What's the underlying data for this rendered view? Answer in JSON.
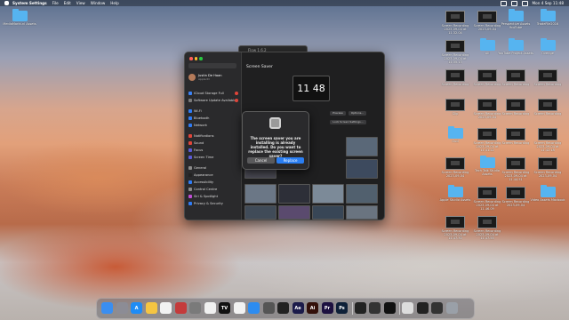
{
  "menubar": {
    "items": [
      "System Settings",
      "File",
      "Edit",
      "View",
      "Window",
      "Help"
    ],
    "clock": "Mon 4 Sep 11:48"
  },
  "desktop_left": [
    {
      "label": "MediaMarkt.nl Assets",
      "kind": "folder"
    }
  ],
  "desktop_right": [
    {
      "label": "Screen Recording 2023-09-04 at 11.32.04",
      "kind": "thumb"
    },
    {
      "label": "Screen Recording 2023-09-04",
      "kind": "thumb"
    },
    {
      "label": "Perspective Assets YouTube",
      "kind": "folder"
    },
    {
      "label": "TradeFile2016",
      "kind": "folder"
    },
    {
      "label": "Screen Recording 2023-09-04 at 11.35.13",
      "kind": "thumb"
    },
    {
      "label": "All",
      "kind": "folder"
    },
    {
      "label": "YouTube Project Assets",
      "kind": "folder"
    },
    {
      "label": "Overige",
      "kind": "folder"
    },
    {
      "label": "Screen Recording",
      "kind": "thumb"
    },
    {
      "label": "Screen Recording",
      "kind": "thumb"
    },
    {
      "label": "Screen Recording",
      "kind": "thumb"
    },
    {
      "label": "Screen Recording",
      "kind": "thumb"
    },
    {
      "label": "Clip",
      "kind": "thumb"
    },
    {
      "label": "Screen Recording 2023-09-04",
      "kind": "thumb"
    },
    {
      "label": "Screen Recording",
      "kind": "thumb"
    },
    {
      "label": "Screen Recording",
      "kind": "thumb"
    },
    {
      "label": "Oud",
      "kind": "folder"
    },
    {
      "label": "Screen Recording 2023-09-04 at 11.41.22",
      "kind": "thumb"
    },
    {
      "label": "Screen Recording",
      "kind": "thumb"
    },
    {
      "label": "Screen Recording 2023-09-04 at 11.42.18",
      "kind": "thumb"
    },
    {
      "label": "Screen Recording 2023-09-04",
      "kind": "thumb"
    },
    {
      "label": "Tech Talk Studio Assets",
      "kind": "folder"
    },
    {
      "label": "Screen Recording 2023-09-04 at 11.44.51",
      "kind": "thumb"
    },
    {
      "label": "Screen Recording 2023-09-04",
      "kind": "thumb"
    },
    {
      "label": "Apple Studio Assets",
      "kind": "folder"
    },
    {
      "label": "Screen Recording 2023-09-04 at 11.46.09",
      "kind": "thumb"
    },
    {
      "label": "Screen Recording 2023-09-04",
      "kind": "thumb"
    },
    {
      "label": "Video Assets Macbook",
      "kind": "folder"
    },
    {
      "label": "Screen Recording 2023-09-04 at 11.47.30",
      "kind": "thumb"
    },
    {
      "label": "Screen Recording 2023-09-04 at 11.47.55",
      "kind": "thumb"
    }
  ],
  "settings": {
    "back_window_title": "Flow 1.6.2",
    "user_name": "Justin De Haan",
    "user_sub": "Apple ID",
    "sidebar_items": [
      {
        "label": "iCloud Storage Full",
        "color": "#3b82f6",
        "badge": true
      },
      {
        "label": "Software Update Available",
        "color": "#7a7a7a",
        "badge": true
      },
      {
        "label": "Wi-Fi",
        "color": "#2f7cf6",
        "badge": false
      },
      {
        "label": "Bluetooth",
        "color": "#2f7cf6",
        "badge": false
      },
      {
        "label": "Network",
        "color": "#2f7cf6",
        "badge": false
      },
      {
        "label": "Notifications",
        "color": "#e0453a",
        "badge": false
      },
      {
        "label": "Sound",
        "color": "#e0453a",
        "badge": false
      },
      {
        "label": "Focus",
        "color": "#5b5bd6",
        "badge": false
      },
      {
        "label": "Screen Time",
        "color": "#5b5bd6",
        "badge": false
      },
      {
        "label": "General",
        "color": "#8a8a8a",
        "badge": false
      },
      {
        "label": "Appearance",
        "color": "#222",
        "badge": false
      },
      {
        "label": "Accessibility",
        "color": "#2f7cf6",
        "badge": false
      },
      {
        "label": "Control Centre",
        "color": "#8a8a8a",
        "badge": false
      },
      {
        "label": "Siri & Spotlight",
        "color": "#c04cd6",
        "badge": false
      },
      {
        "label": "Privacy & Security",
        "color": "#2f7cf6",
        "badge": false
      }
    ],
    "page_title": "Screen Saver",
    "preview_time": "11 48",
    "preview_button": "Preview",
    "options_button": "Options...",
    "lock_button": "Lock Screen Settings..."
  },
  "dialog": {
    "message": "The screen saver you are installing is already installed. Do you want to replace the existing screen saver?",
    "cancel": "Cancel",
    "replace": "Replace"
  },
  "dock": [
    {
      "name": "Finder",
      "color": "#3a8ef0",
      "glyph": ""
    },
    {
      "name": "Launchpad",
      "color": "#8c8c95",
      "glyph": ""
    },
    {
      "name": "App Store",
      "color": "#1f8cf5",
      "glyph": "A"
    },
    {
      "name": "Notes",
      "color": "#f5c542",
      "glyph": ""
    },
    {
      "name": "Calendar",
      "color": "#f2f2f2",
      "glyph": ""
    },
    {
      "name": "Photo Booth",
      "color": "#c43b3b",
      "glyph": ""
    },
    {
      "name": "System Settings",
      "color": "#7a7a7a",
      "glyph": ""
    },
    {
      "name": "Photos",
      "color": "#f0f0f0",
      "glyph": ""
    },
    {
      "name": "TV",
      "color": "#111",
      "glyph": "TV"
    },
    {
      "name": "Chrome",
      "color": "#f2f2f2",
      "glyph": ""
    },
    {
      "name": "Safari",
      "color": "#2d8cf0",
      "glyph": ""
    },
    {
      "name": "Compressor",
      "color": "#555",
      "glyph": ""
    },
    {
      "name": "Final Cut Pro",
      "color": "#222",
      "glyph": ""
    },
    {
      "name": "After Effects",
      "color": "#1b1b4a",
      "glyph": "Ae"
    },
    {
      "name": "Illustrator",
      "color": "#33100a",
      "glyph": "Ai"
    },
    {
      "name": "Premiere Pro",
      "color": "#1d1140",
      "glyph": "Pr"
    },
    {
      "name": "Photoshop",
      "color": "#0e2038",
      "glyph": "Ps"
    },
    {
      "name": "Terminal",
      "color": "#222",
      "glyph": ""
    },
    {
      "name": "Activity Monitor",
      "color": "#333",
      "glyph": ""
    },
    {
      "name": "CapCut",
      "color": "#111",
      "glyph": ""
    },
    {
      "name": "Preview",
      "color": "#ddd",
      "glyph": ""
    },
    {
      "name": "Window 1",
      "color": "#222",
      "glyph": ""
    },
    {
      "name": "Window 2",
      "color": "#333",
      "glyph": ""
    },
    {
      "name": "Trash",
      "color": "#9aa0a8",
      "glyph": ""
    }
  ]
}
